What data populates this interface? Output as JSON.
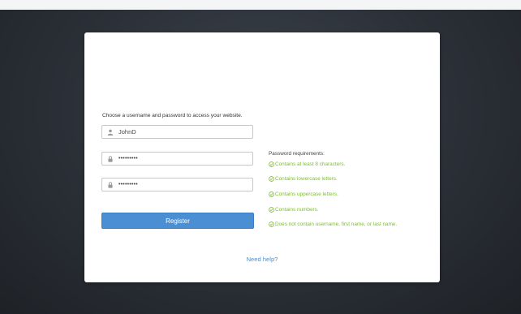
{
  "form": {
    "instruction": "Choose a username and password to access your website.",
    "username_value": "JohnD",
    "password_value": "password1",
    "confirm_value": "password1",
    "register_label": "Register",
    "help_link": "Need help?"
  },
  "requirements": {
    "title": "Password requirements:",
    "items": [
      "Contains at least 8 characters.",
      "Contains lowercase letters.",
      "Contains uppercase letters.",
      "Contains numbers.",
      "Does not contain username, first name, or last name."
    ]
  },
  "colors": {
    "accent": "#4a8fd4",
    "success": "#7bbf2d",
    "background": "#2a2f36"
  },
  "icons": {
    "username": "user-icon",
    "password": "lock-icon",
    "requirement": "check-circle-icon"
  }
}
